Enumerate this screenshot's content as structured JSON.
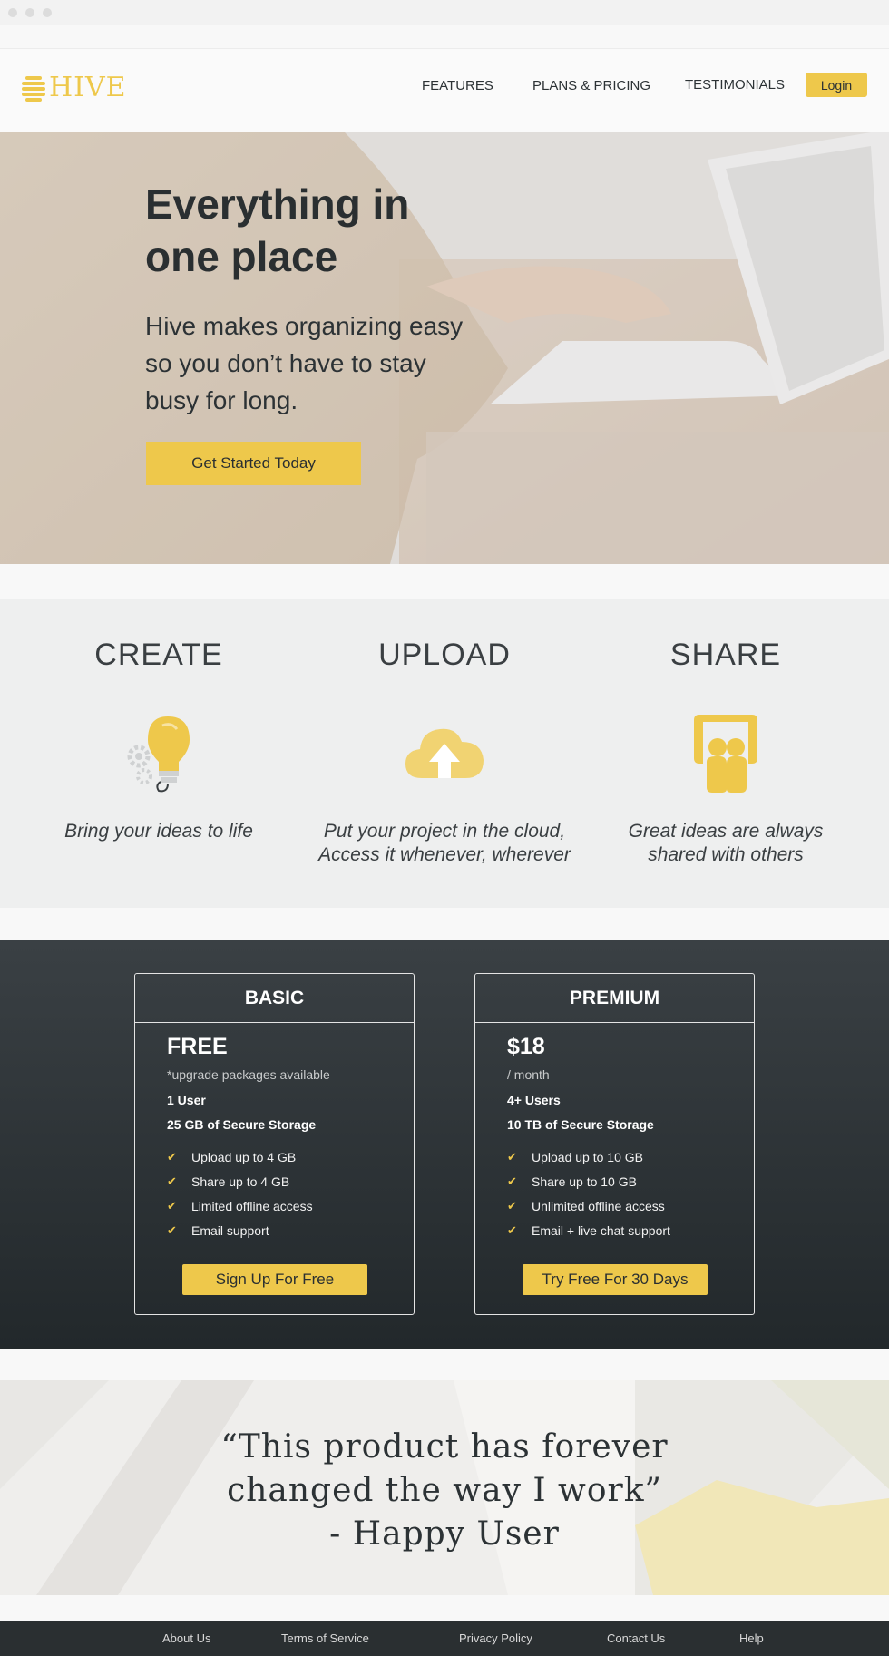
{
  "brand": {
    "name": "HIVE",
    "accent": "#eec84b",
    "dark": "#2a2f31"
  },
  "nav": {
    "features": "FEATURES",
    "plans": "PLANS & PRICING",
    "testimonials": "TESTIMONIALS",
    "login": "Login"
  },
  "hero": {
    "title_line1": "Everything in",
    "title_line2": "one place",
    "sub_line1": "Hive makes organizing easy",
    "sub_line2": "so you don’t have to stay",
    "sub_line3": "busy for long.",
    "cta": "Get Started Today"
  },
  "features": [
    {
      "title": "CREATE",
      "icon": "lightbulb-icon",
      "line1": "Bring your ideas to life",
      "line2": ""
    },
    {
      "title": "UPLOAD",
      "icon": "cloud-upload-icon",
      "line1": "Put your project in the cloud,",
      "line2": "Access it whenever, wherever"
    },
    {
      "title": "SHARE",
      "icon": "share-people-icon",
      "line1": "Great ideas are always",
      "line2": "shared with others"
    }
  ],
  "plans": [
    {
      "name": "BASIC",
      "price": "FREE",
      "note": "*upgrade packages available",
      "users": "1 User",
      "storage": "25 GB of Secure Storage",
      "features": [
        "Upload up to 4 GB",
        "Share up to 4 GB",
        "Limited offline access",
        "Email support"
      ],
      "button": "Sign Up For Free"
    },
    {
      "name": "PREMIUM",
      "price": "$18",
      "note": "/ month",
      "users": "4+ Users",
      "storage": "10 TB of Secure Storage",
      "features": [
        "Upload up to 10 GB",
        "Share up to 10 GB",
        "Unlimited offline access",
        "Email + live chat support"
      ],
      "button": "Try Free For 30 Days"
    }
  ],
  "testimonial": {
    "line1": "“This product has forever",
    "line2": "changed the way I work”",
    "line3": "- Happy User"
  },
  "footer": {
    "about": "About Us",
    "terms": "Terms of Service",
    "privacy": "Privacy Policy",
    "contact": "Contact Us",
    "help": "Help"
  }
}
